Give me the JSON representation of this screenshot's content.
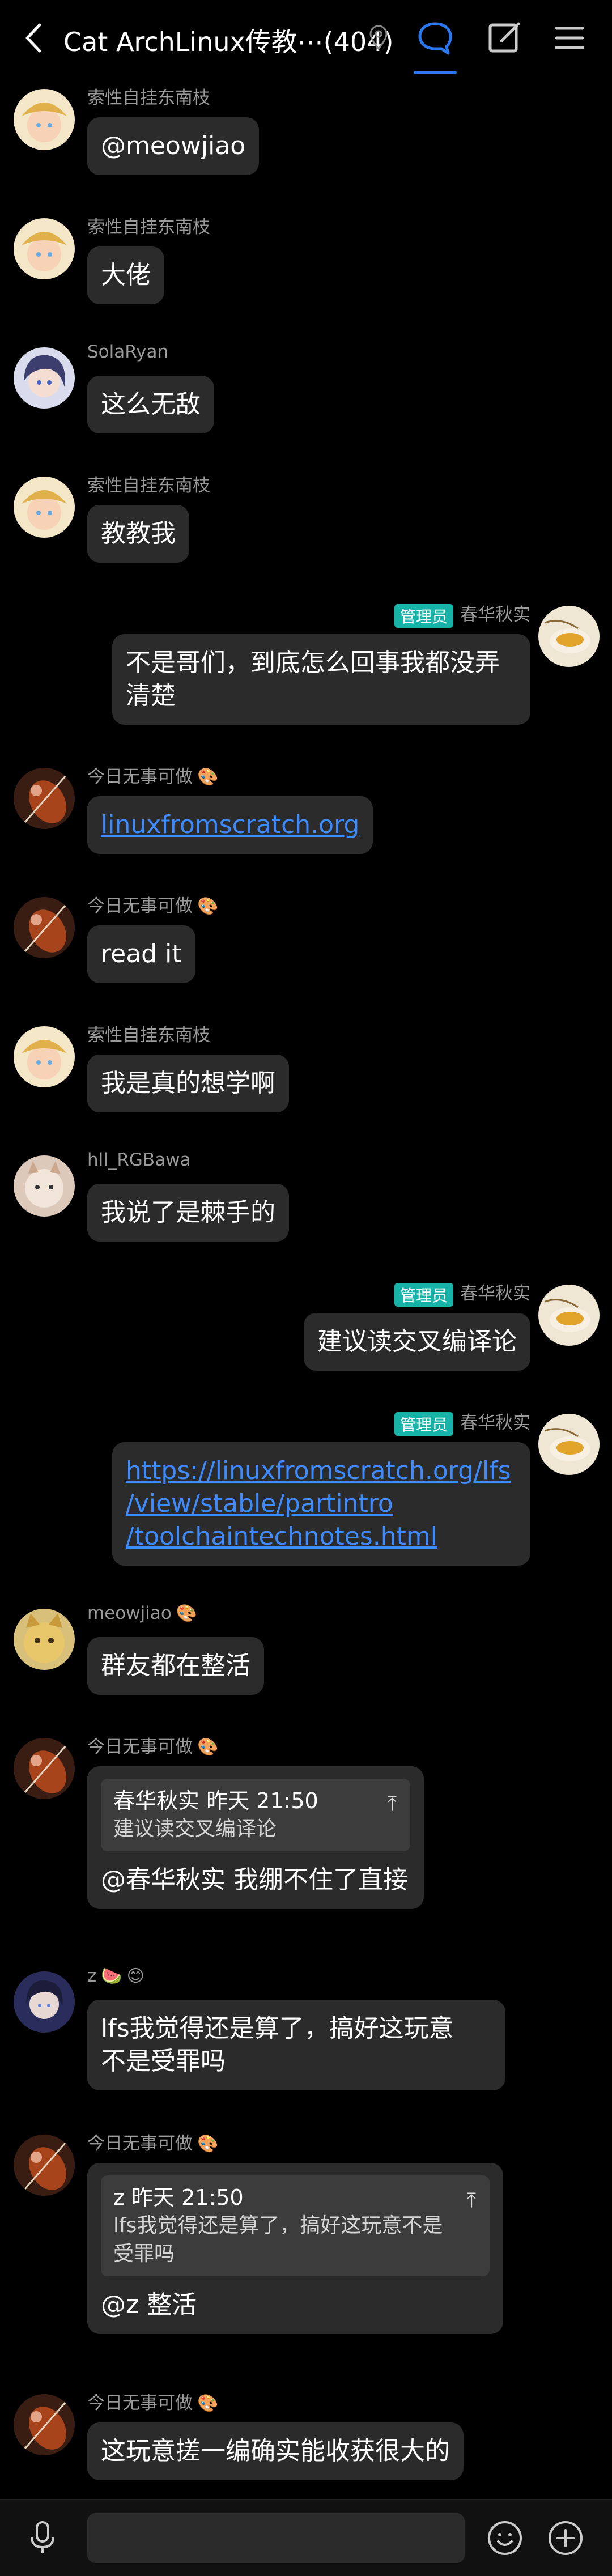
{
  "header": {
    "title": "Cat ArchLinux传教⋯(404)",
    "icons": [
      "back-icon",
      "location-pin-icon",
      "chat-bubble-icon",
      "edit-icon",
      "menu-icon"
    ],
    "accent": "#2b78f0"
  },
  "badge_color": "#17b3a8",
  "link_color": "#3d8bff",
  "messages": [
    {
      "sender": "索性自挂东南枝",
      "text": "@meowjiao"
    },
    {
      "sender": "索性自挂东南枝",
      "text": "大佬"
    },
    {
      "sender": "SolaRyan",
      "text": "这么无敌"
    },
    {
      "sender": "索性自挂东南枝",
      "text": "教教我"
    },
    {
      "sender": "春华秋实",
      "badge": "管理员",
      "line1": "不是哥们，到底怎么回事我都没弄",
      "line2": "清楚"
    },
    {
      "sender": "今日无事可做",
      "text": "linuxfromscratch.org"
    },
    {
      "sender": "今日无事可做",
      "text": "read it"
    },
    {
      "sender": "索性自挂东南枝",
      "text": "我是真的想学啊"
    },
    {
      "sender": "hll_RGBawa",
      "text": "我说了是棘手的"
    },
    {
      "sender": "春华秋实",
      "badge": "管理员",
      "text": "建议读交叉编译论"
    },
    {
      "sender": "春华秋实",
      "badge": "管理员",
      "line1": "https://linuxfromscratch.org/lfs",
      "line2": "/view/stable/partintro",
      "line3": "/toolchaintechnotes.html"
    },
    {
      "sender": "meowjiao",
      "text": "群友都在整活"
    },
    {
      "sender": "今日无事可做",
      "quote_head": "春华秋实 昨天 21:50",
      "quote_body": "建议读交叉编译论",
      "text": "@春华秋实 我绷不住了直接"
    },
    {
      "sender": "z",
      "line1": "lfs我觉得还是算了，搞好这玩意",
      "line2": "不是受罪吗"
    },
    {
      "sender": "今日无事可做",
      "quote_head": "z 昨天 21:50",
      "quote_line1": "lfs我觉得还是算了，搞好这玩意不是",
      "quote_line2": "受罪吗",
      "text": "@z 整活"
    },
    {
      "sender": "今日无事可做",
      "text": "这玩意搓一编确实能收获很大的"
    }
  ],
  "quote_arrow": "⤒",
  "bottom_bar": {
    "icons": [
      "microphone-icon",
      "emoji-icon",
      "plus-icon"
    ],
    "input_value": ""
  }
}
